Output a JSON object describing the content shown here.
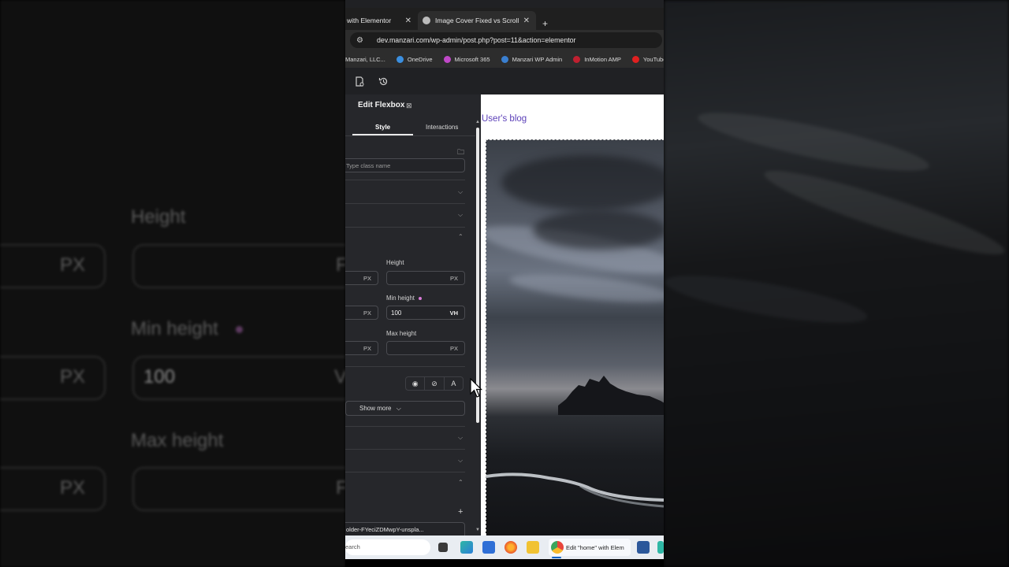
{
  "background": {
    "left_labels": {
      "height": "Height",
      "min_height": "Min height",
      "max_height": "Max height",
      "px1": "PX",
      "px2": "PX",
      "px3": "PX",
      "value": "100",
      "trunc_f1": "F",
      "trunc_v": "V",
      "trunc_f2": "F"
    }
  },
  "browser": {
    "tabs": [
      {
        "label": "with Elementor",
        "close": "✕"
      },
      {
        "label": "Image Cover Fixed vs Scroll",
        "close": "✕"
      }
    ],
    "new_tab": "+",
    "url": "dev.manzari.com/wp-admin/post.php?post=11&action=elementor",
    "bookmarks": [
      {
        "label": "Manzari, LLC...",
        "color": "#888888"
      },
      {
        "label": "OneDrive",
        "color": "#3b8fe0"
      },
      {
        "label": "Microsoft 365",
        "color": "#c048c8"
      },
      {
        "label": "Manzari WP Admin",
        "color": "#3a7fd0"
      },
      {
        "label": "InMotion AMP",
        "color": "#c02030"
      },
      {
        "label": "YouTube",
        "color": "#e02020"
      }
    ]
  },
  "editor": {
    "panel_title": "Edit Flexbox",
    "tabs": {
      "style": "Style",
      "interactions": "Interactions"
    },
    "class_placeholder": "Type class name",
    "size": {
      "height_label": "Height",
      "min_height_label": "Min height",
      "max_height_label": "Max height",
      "width_unit": "PX",
      "height_unit": "PX",
      "min_width_unit": "PX",
      "min_height_value": "100",
      "min_height_unit": "VH",
      "max_width_unit": "PX",
      "max_height_unit": "PX"
    },
    "show_more": "Show more",
    "bg_image_file": "older-FYeciZDMwpY-unspla...",
    "add_icon": "+"
  },
  "preview": {
    "blog_title": "User's blog"
  },
  "taskbar": {
    "search_placeholder": "earch",
    "active_app_label": "Edit \"home\" with Elem"
  }
}
